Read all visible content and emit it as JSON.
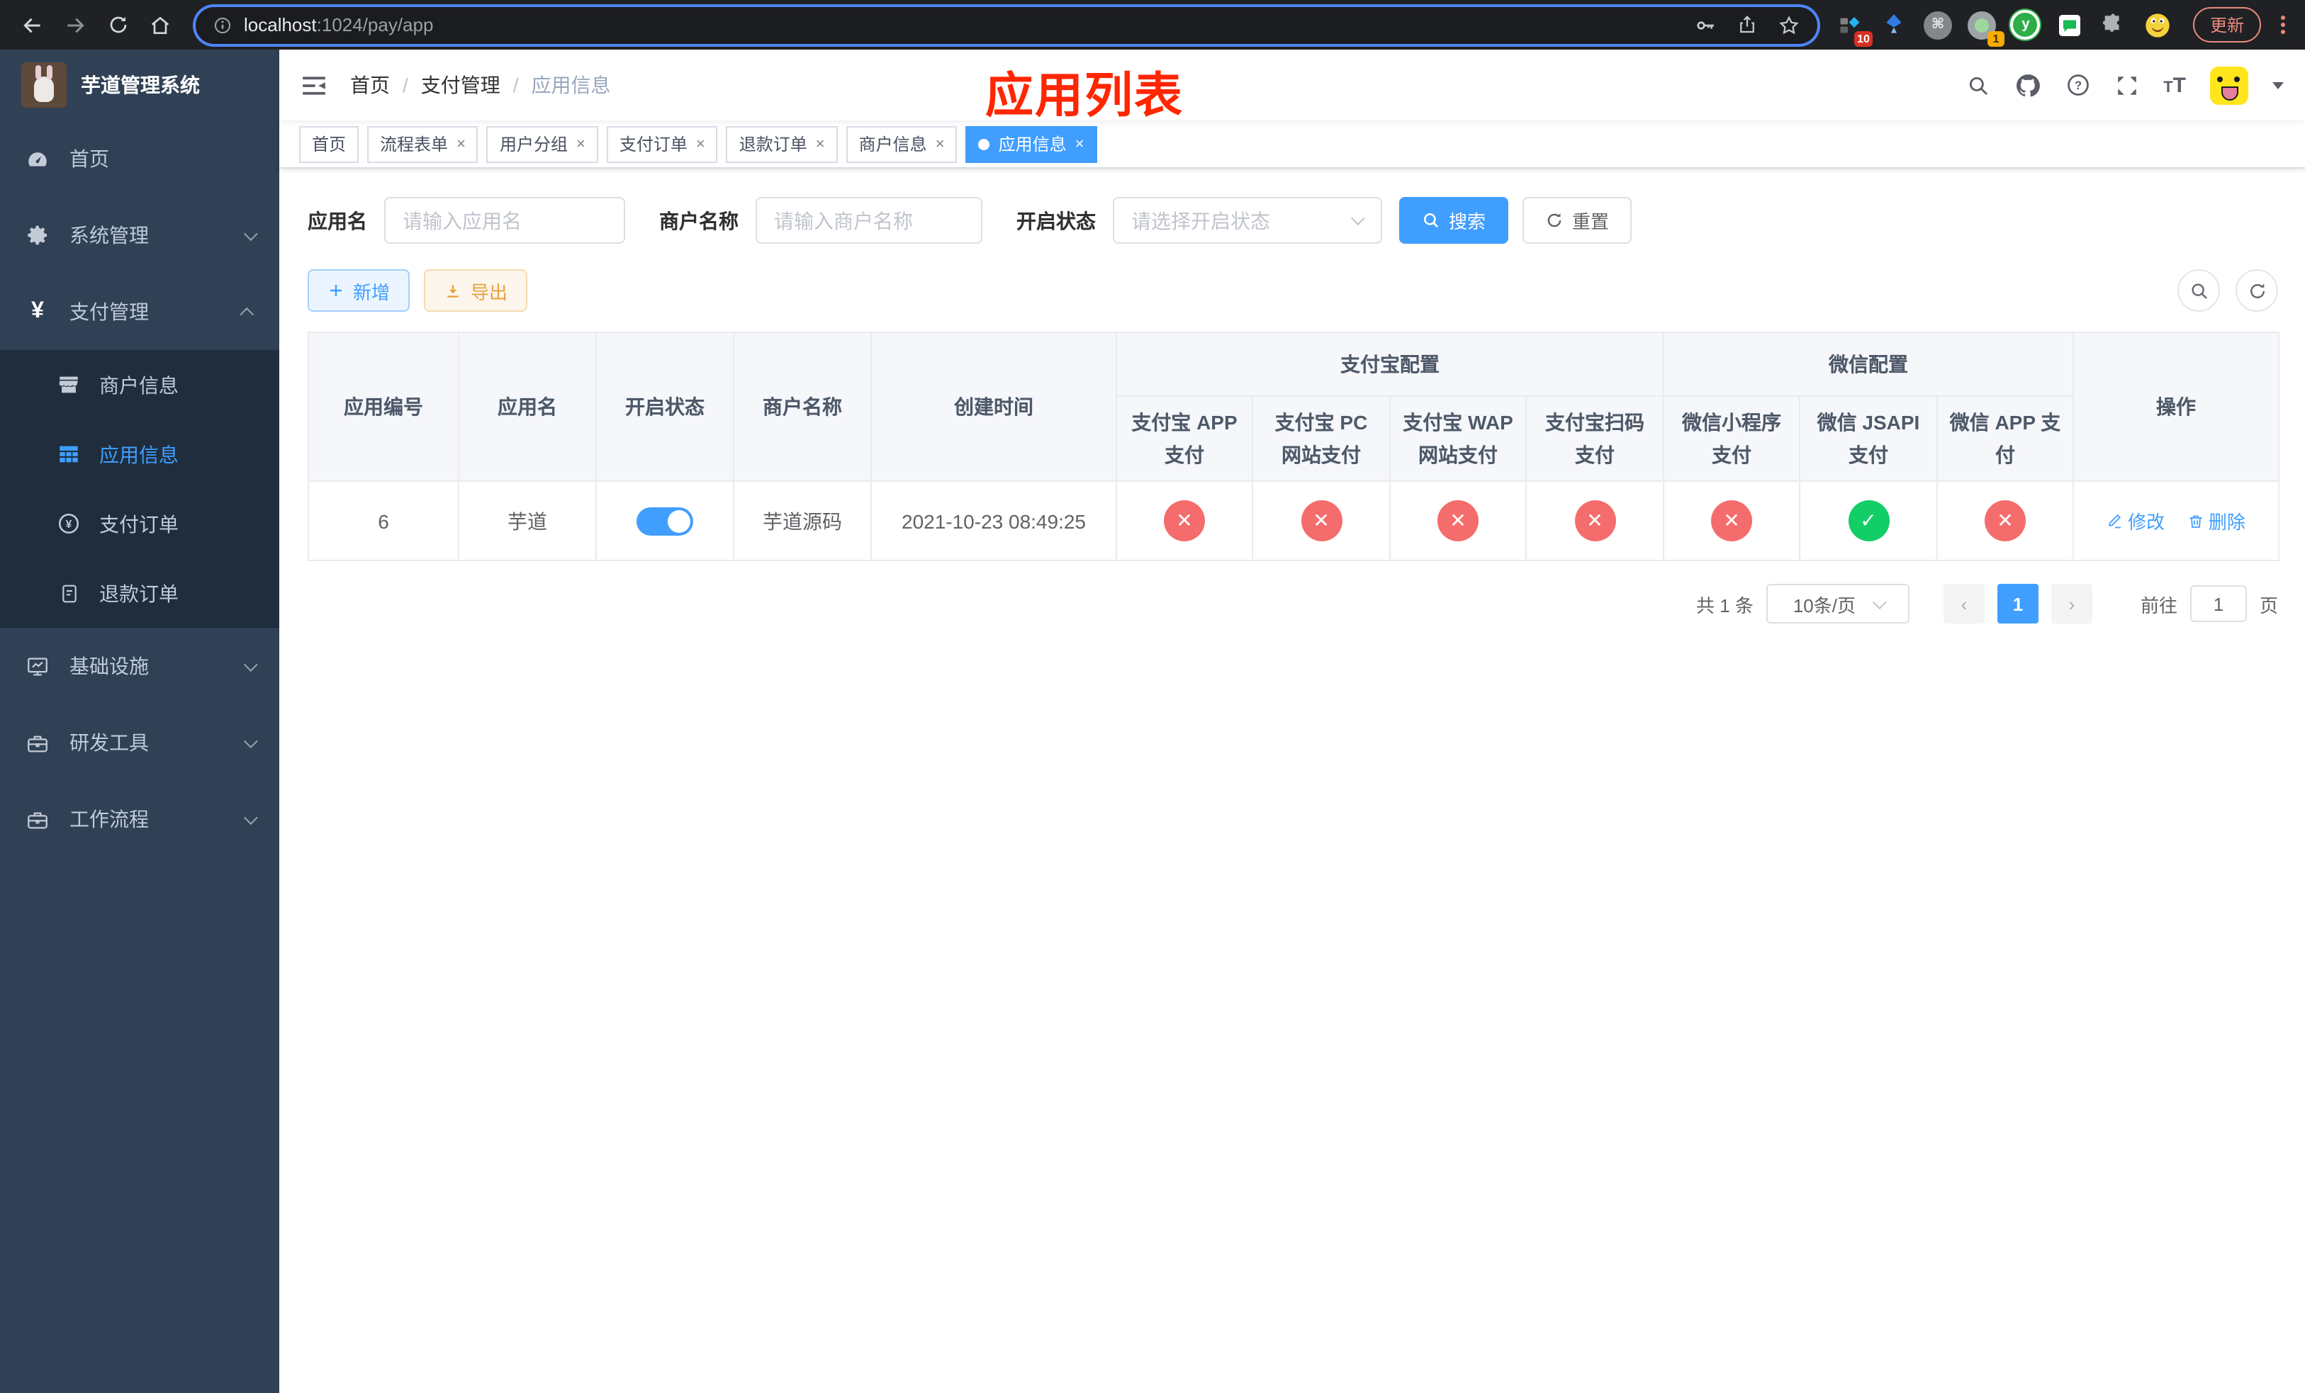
{
  "colors": {
    "accent": "#409EFF",
    "success": "#13CE66",
    "danger": "#F56C6C",
    "warning": "#E6A23C",
    "sidebar_bg": "#304156",
    "submenu_bg": "#1F2D3D",
    "annotation_red": "#FF2600"
  },
  "browser": {
    "url_host": "localhost",
    "url_path": ":1024/pay/app",
    "ext_badge_1": "10",
    "ext_badge_2": "1",
    "update_button": "更新"
  },
  "sidebar": {
    "title": "芋道管理系统",
    "items": [
      {
        "label": "首页"
      },
      {
        "label": "系统管理"
      },
      {
        "label": "支付管理"
      },
      {
        "label": "商户信息"
      },
      {
        "label": "应用信息"
      },
      {
        "label": "支付订单"
      },
      {
        "label": "退款订单"
      },
      {
        "label": "基础设施"
      },
      {
        "label": "研发工具"
      },
      {
        "label": "工作流程"
      }
    ]
  },
  "navbar": {
    "breadcrumb": [
      "首页",
      "支付管理",
      "应用信息"
    ],
    "annotation": "应用列表"
  },
  "tags": {
    "items": [
      {
        "label": "首页"
      },
      {
        "label": "流程表单"
      },
      {
        "label": "用户分组"
      },
      {
        "label": "支付订单"
      },
      {
        "label": "退款订单"
      },
      {
        "label": "商户信息"
      },
      {
        "label": "应用信息"
      }
    ]
  },
  "filters": {
    "app_name_label": "应用名",
    "app_name_placeholder": "请输入应用名",
    "merchant_label": "商户名称",
    "merchant_placeholder": "请输入商户名称",
    "status_label": "开启状态",
    "status_placeholder": "请选择开启状态",
    "search_button": "搜索",
    "reset_button": "重置"
  },
  "toolbar": {
    "add_button": "新增",
    "export_button": "导出"
  },
  "table": {
    "headers": {
      "app_id": "应用编号",
      "app_name": "应用名",
      "status": "开启状态",
      "merchant": "商户名称",
      "create_time": "创建时间",
      "alipay_group": "支付宝配置",
      "wechat_group": "微信配置",
      "alipay_app": "支付宝 APP 支付",
      "alipay_pc": "支付宝 PC 网站支付",
      "alipay_wap": "支付宝 WAP 网站支付",
      "alipay_qr": "支付宝扫码支付",
      "wx_lite": "微信小程序支付",
      "wx_jsapi": "微信 JSAPI 支付",
      "wx_app": "微信 APP 支付",
      "actions": "操作"
    },
    "status_true_icon": "✓",
    "status_false_icon": "✕",
    "row": {
      "id": "6",
      "name": "芋道",
      "enabled": true,
      "merchant": "芋道源码",
      "create_time": "2021-10-23 08:49:25",
      "pay_status": [
        false,
        false,
        false,
        false,
        false,
        true,
        false
      ],
      "edit_label": "修改",
      "delete_label": "删除"
    }
  },
  "pagination": {
    "total_text": "共 1 条",
    "page_size": "10条/页",
    "current_page": "1",
    "goto_label": "前往",
    "goto_value": "1",
    "page_unit": "页"
  }
}
